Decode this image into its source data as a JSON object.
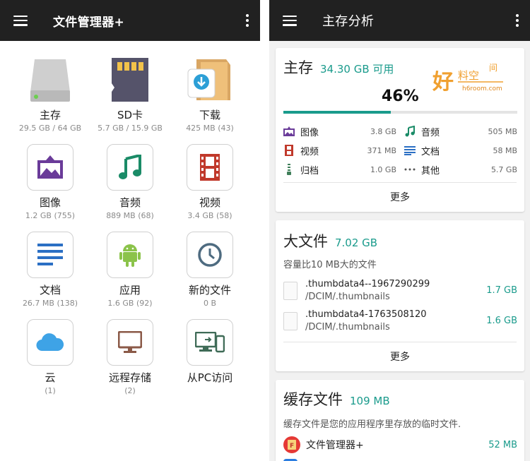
{
  "left": {
    "title": "文件管理器+",
    "items": [
      {
        "label": "主存",
        "sub": "29.5 GB / 64 GB",
        "icon": "hard-drive-icon"
      },
      {
        "label": "SD卡",
        "sub": "5.7 GB / 15.9 GB",
        "icon": "sd-card-icon"
      },
      {
        "label": "下载",
        "sub": "425 MB (43)",
        "icon": "download-folder-icon"
      },
      {
        "label": "图像",
        "sub": "1.2 GB (755)",
        "icon": "image-icon"
      },
      {
        "label": "音频",
        "sub": "889 MB (68)",
        "icon": "music-note-icon"
      },
      {
        "label": "视频",
        "sub": "3.4 GB (58)",
        "icon": "film-icon"
      },
      {
        "label": "文档",
        "sub": "26.7 MB (138)",
        "icon": "document-lines-icon"
      },
      {
        "label": "应用",
        "sub": "1.6 GB (92)",
        "icon": "android-icon"
      },
      {
        "label": "新的文件",
        "sub": "0 B",
        "icon": "clock-icon"
      },
      {
        "label": "云",
        "sub": "(1)",
        "icon": "cloud-icon"
      },
      {
        "label": "远程存储",
        "sub": "(2)",
        "icon": "monitor-icon"
      },
      {
        "label": "从PC访问",
        "sub": "",
        "icon": "pc-phone-icon"
      }
    ]
  },
  "right": {
    "title": "主存分析",
    "storage": {
      "title": "主存",
      "available": "34.30 GB 可用",
      "percent_label": "46%",
      "used_fraction": 0.46,
      "categories": [
        {
          "name": "图像",
          "value": "3.8 GB",
          "icon": "image-icon"
        },
        {
          "name": "音频",
          "value": "505 MB",
          "icon": "music-note-icon"
        },
        {
          "name": "视频",
          "value": "371 MB",
          "icon": "film-icon"
        },
        {
          "name": "文档",
          "value": "58 MB",
          "icon": "document-lines-icon"
        },
        {
          "name": "归档",
          "value": "1.0 GB",
          "icon": "archive-zipper-icon"
        },
        {
          "name": "其他",
          "value": "5.7 GB",
          "icon": "dots-icon"
        }
      ],
      "more": "更多"
    },
    "large_files": {
      "title": "大文件",
      "total": "7.02 GB",
      "desc": "容量比10 MB大的文件",
      "files": [
        {
          "name": ".thumbdata4--1967290299",
          "path": "/DCIM/.thumbnails",
          "size": "1.7 GB"
        },
        {
          "name": ".thumbdata4-1763508120",
          "path": "/DCIM/.thumbnails",
          "size": "1.6 GB"
        }
      ],
      "more": "更多"
    },
    "cache": {
      "title": "缓存文件",
      "total": "109 MB",
      "desc": "缓存文件是您的应用程序里存放的临时文件.",
      "apps": [
        {
          "name": "文件管理器+",
          "size": "52 MB"
        }
      ]
    },
    "watermark": {
      "logo": "好料空间",
      "site": "h6room.com"
    }
  },
  "colors": {
    "accent": "#1a9b8c",
    "appbar": "#212121"
  }
}
